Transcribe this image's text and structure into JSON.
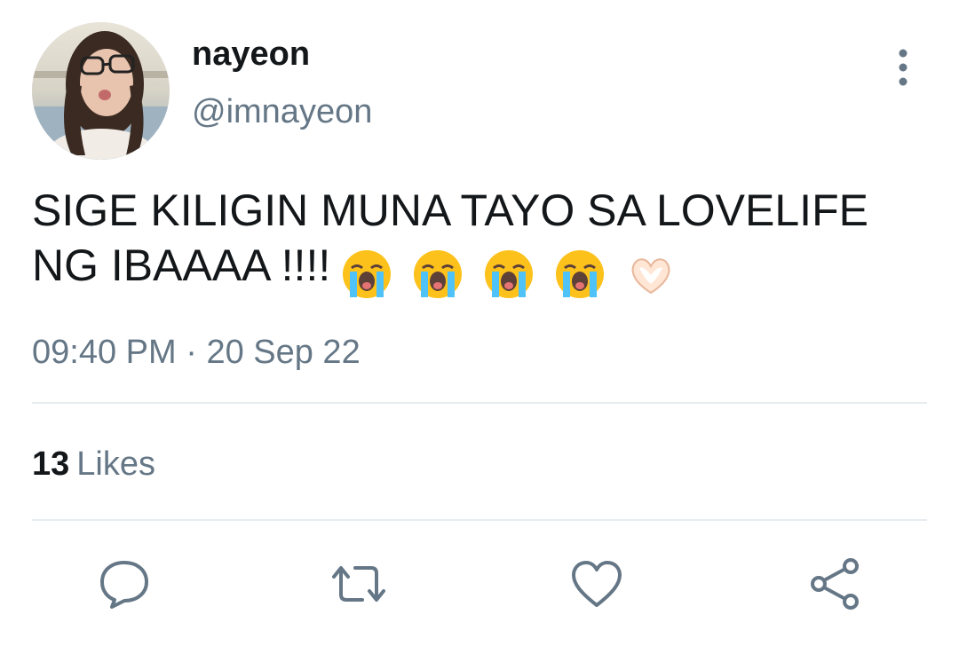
{
  "tweet": {
    "author": {
      "display_name": "nayeon",
      "handle": "@imnayeon"
    },
    "text_line1": "SIGE KILIGIN MUNA TAYO SA LOVELIFE",
    "text_line2": "NG IBAAAA !!!!",
    "emojis": [
      "loudly-crying-face",
      "loudly-crying-face",
      "loudly-crying-face",
      "loudly-crying-face",
      "heart-hands"
    ],
    "time": "09:40 PM",
    "separator": "·",
    "date": "20 Sep 22",
    "likes_count": "13",
    "likes_label": "Likes"
  },
  "actions": [
    "reply-icon",
    "retweet-icon",
    "like-icon",
    "share-icon"
  ],
  "colors": {
    "text": "#14171a",
    "secondary": "#657786",
    "divider": "#e6ecf0"
  }
}
